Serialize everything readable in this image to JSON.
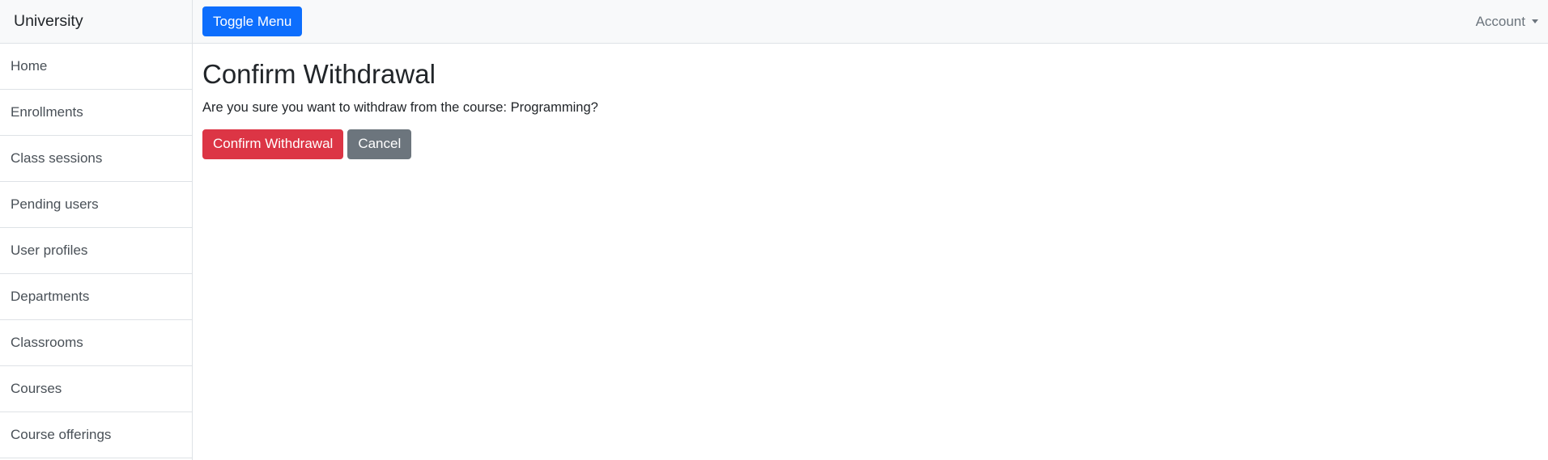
{
  "sidebar": {
    "heading": "University",
    "items": [
      {
        "label": "Home"
      },
      {
        "label": "Enrollments"
      },
      {
        "label": "Class sessions"
      },
      {
        "label": "Pending users"
      },
      {
        "label": "User profiles"
      },
      {
        "label": "Departments"
      },
      {
        "label": "Classrooms"
      },
      {
        "label": "Courses"
      },
      {
        "label": "Course offerings"
      }
    ]
  },
  "topbar": {
    "toggle_label": "Toggle Menu",
    "account_label": "Account"
  },
  "main": {
    "title": "Confirm Withdrawal",
    "message": "Are you sure you want to withdraw from the course: Programming?",
    "confirm_label": "Confirm Withdrawal",
    "cancel_label": "Cancel"
  },
  "colors": {
    "primary": "#0d6efd",
    "danger": "#dc3545",
    "secondary": "#6c757d"
  }
}
